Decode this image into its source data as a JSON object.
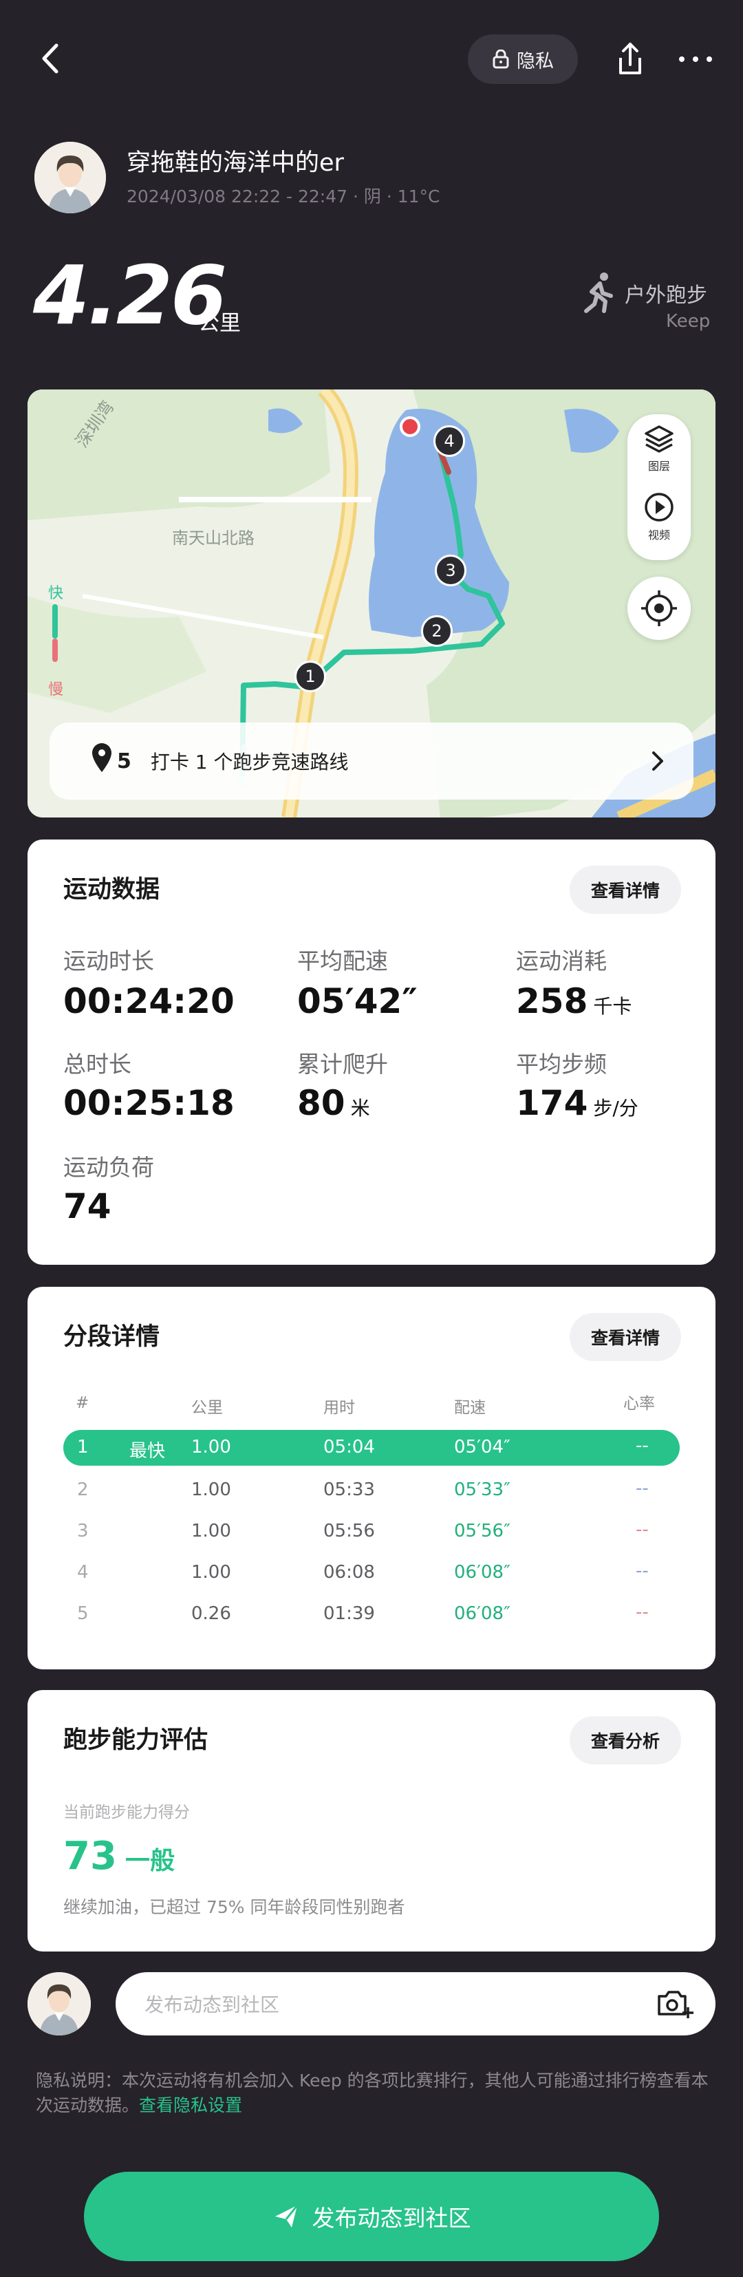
{
  "header": {
    "privacy_label": "隐私"
  },
  "profile": {
    "username": "穿拖鞋的海洋中的er",
    "meta": "2024/03/08 22:22 - 22:47 · 阴 · 11°C"
  },
  "summary": {
    "distance": "4.26",
    "distance_unit": "公里",
    "sport_type": "户外跑步",
    "source": "Keep"
  },
  "map": {
    "road_labels": [
      "深圳湾",
      "南天山北路"
    ],
    "legend_fast": "快",
    "legend_slow": "慢",
    "layers_label": "图层",
    "video_label": "视频",
    "markers": [
      "1",
      "2",
      "3",
      "4"
    ],
    "checkin_text": "打卡 1 个跑步竞速路线",
    "checkin_icon_count": "5"
  },
  "workout": {
    "title": "运动数据",
    "details_button": "查看详情",
    "stats": [
      {
        "label": "运动时长",
        "value": "00:24:20",
        "unit": ""
      },
      {
        "label": "平均配速",
        "value": "05′42″",
        "unit": ""
      },
      {
        "label": "运动消耗",
        "value": "258",
        "unit": "千卡"
      },
      {
        "label": "总时长",
        "value": "00:25:18",
        "unit": ""
      },
      {
        "label": "累计爬升",
        "value": "80",
        "unit": "米"
      },
      {
        "label": "平均步频",
        "value": "174",
        "unit": "步/分"
      },
      {
        "label": "运动负荷",
        "value": "74",
        "unit": ""
      }
    ]
  },
  "splits": {
    "title": "分段详情",
    "details_button": "查看详情",
    "headers": [
      "#",
      "公里",
      "用时",
      "配速",
      "心率"
    ],
    "fastest_tag": "最快",
    "rows": [
      {
        "n": "1",
        "km": "1.00",
        "time": "05:04",
        "pace": "05′04″",
        "hr": "--"
      },
      {
        "n": "2",
        "km": "1.00",
        "time": "05:33",
        "pace": "05′33″",
        "hr": "--"
      },
      {
        "n": "3",
        "km": "1.00",
        "time": "05:56",
        "pace": "05′56″",
        "hr": "--"
      },
      {
        "n": "4",
        "km": "1.00",
        "time": "06:08",
        "pace": "06′08″",
        "hr": "--"
      },
      {
        "n": "5",
        "km": "0.26",
        "time": "01:39",
        "pace": "06′08″",
        "hr": "--"
      }
    ]
  },
  "assessment": {
    "title": "跑步能力评估",
    "analysis_button": "查看分析",
    "score_label": "当前跑步能力得分",
    "score": "73",
    "level": "一般",
    "description": "继续加油，已超过 75% 同年龄段同性别跑者"
  },
  "comment": {
    "placeholder": "发布动态到社区"
  },
  "privacy_note": {
    "text": "隐私说明：本次运动将有机会加入 Keep 的各项比赛排行，其他人可能通过排行榜查看本次运动数据。",
    "link": "查看隐私设置"
  },
  "publish_button": "发布动态到社区",
  "colors": {
    "background": "#26222a",
    "accent": "#27c38a",
    "card": "#ffffff"
  }
}
